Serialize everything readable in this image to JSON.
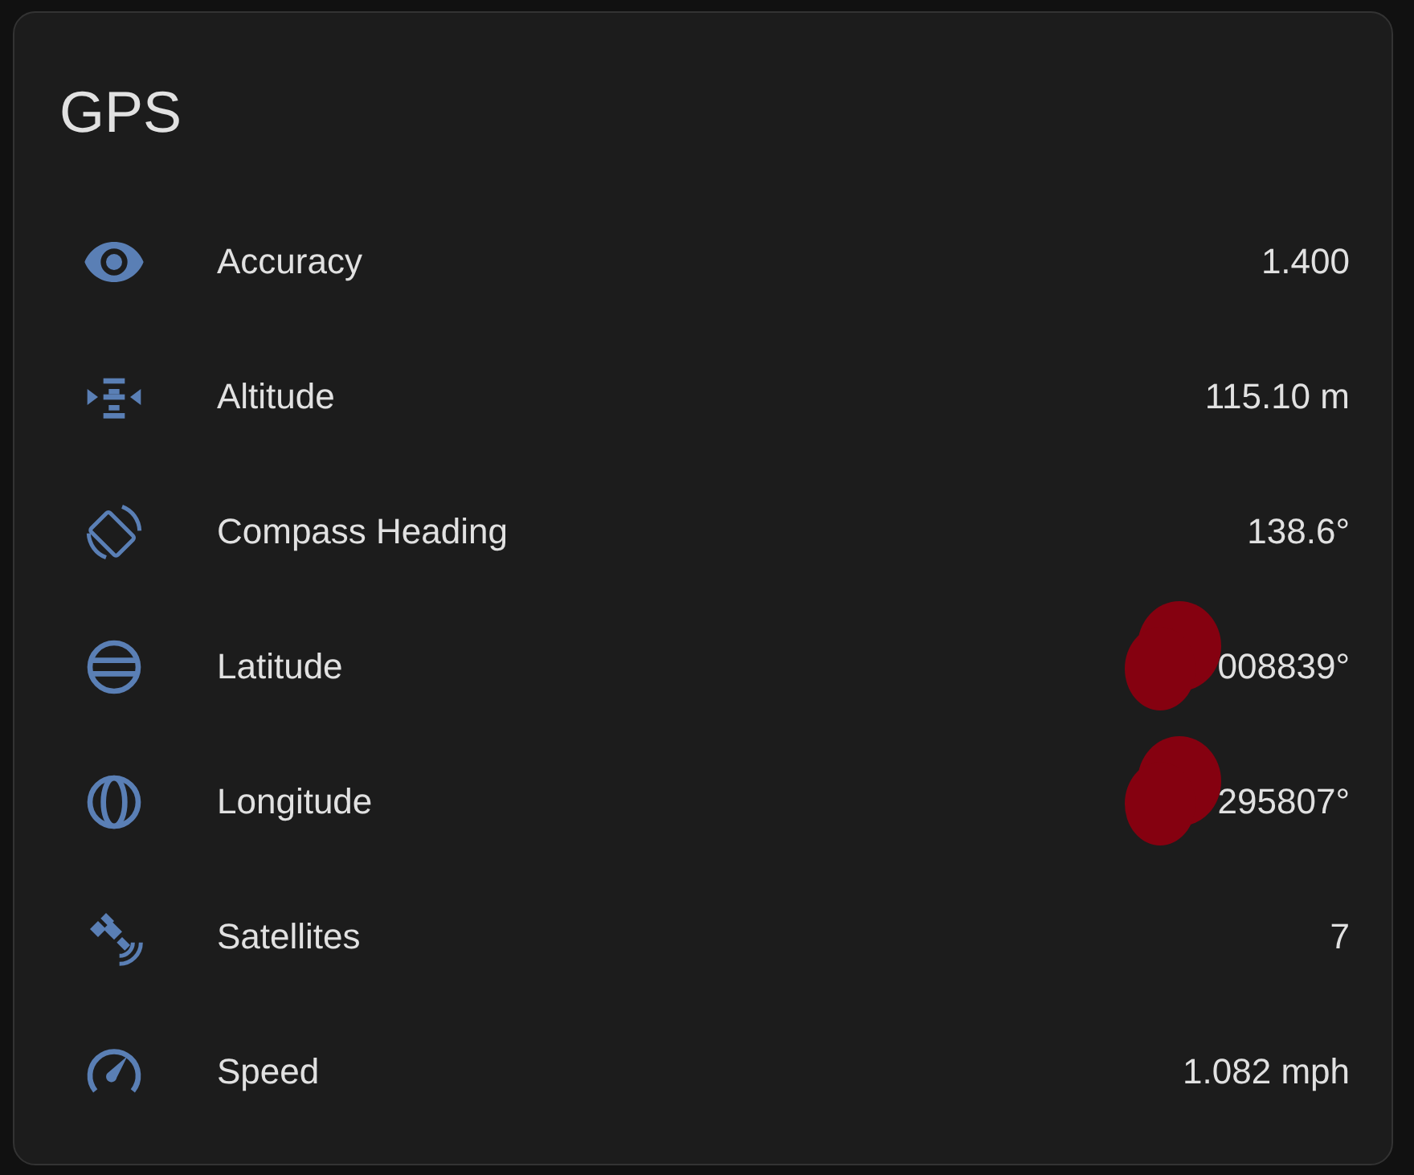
{
  "card": {
    "title": "GPS"
  },
  "rows": [
    {
      "kind": "eye",
      "label": "Accuracy",
      "value": "1.400",
      "redacted": false
    },
    {
      "kind": "altitude",
      "label": "Altitude",
      "value": "115.10 m",
      "redacted": false
    },
    {
      "kind": "rotate",
      "label": "Compass Heading",
      "value": "138.6°",
      "redacted": false
    },
    {
      "kind": "latitude",
      "label": "Latitude",
      "value": "008839°",
      "redacted": true
    },
    {
      "kind": "longitude",
      "label": "Longitude",
      "value": "295807°",
      "redacted": true
    },
    {
      "kind": "satellite",
      "label": "Satellites",
      "value": "7",
      "redacted": false
    },
    {
      "kind": "speed",
      "label": "Speed",
      "value": "1.082 mph",
      "redacted": false
    }
  ]
}
